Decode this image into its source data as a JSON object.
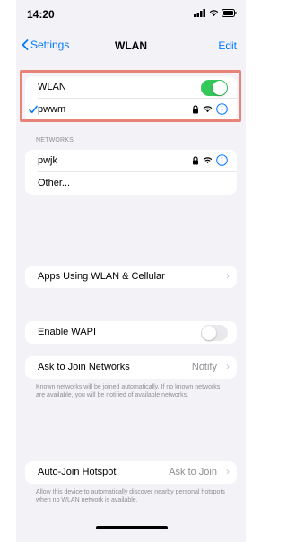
{
  "status_bar": {
    "time": "14:20"
  },
  "nav": {
    "back_label": "Settings",
    "title": "WLAN",
    "edit_label": "Edit"
  },
  "wlan_group": {
    "toggle_label": "WLAN",
    "toggle_on": true,
    "connected_network": "pwwm"
  },
  "networks": {
    "header": "NETWORKS",
    "items": [
      {
        "name": "pwjk"
      }
    ],
    "other_label": "Other..."
  },
  "apps_using": {
    "label": "Apps Using WLAN & Cellular"
  },
  "wapi": {
    "label": "Enable WAPI",
    "toggle_on": false
  },
  "ask_to_join": {
    "label": "Ask to Join Networks",
    "value": "Notify",
    "caption": "Known networks will be joined automatically. If no known networks are available, you will be notified of available networks."
  },
  "auto_join_hotspot": {
    "label": "Auto-Join Hotspot",
    "value": "Ask to Join",
    "caption": "Allow this device to automatically discover nearby personal hotspots when no WLAN network is available."
  },
  "colors": {
    "accent": "#007aff",
    "toggle_on": "#34c759",
    "highlight_border": "#e8837a",
    "background": "#f2f2f7"
  }
}
